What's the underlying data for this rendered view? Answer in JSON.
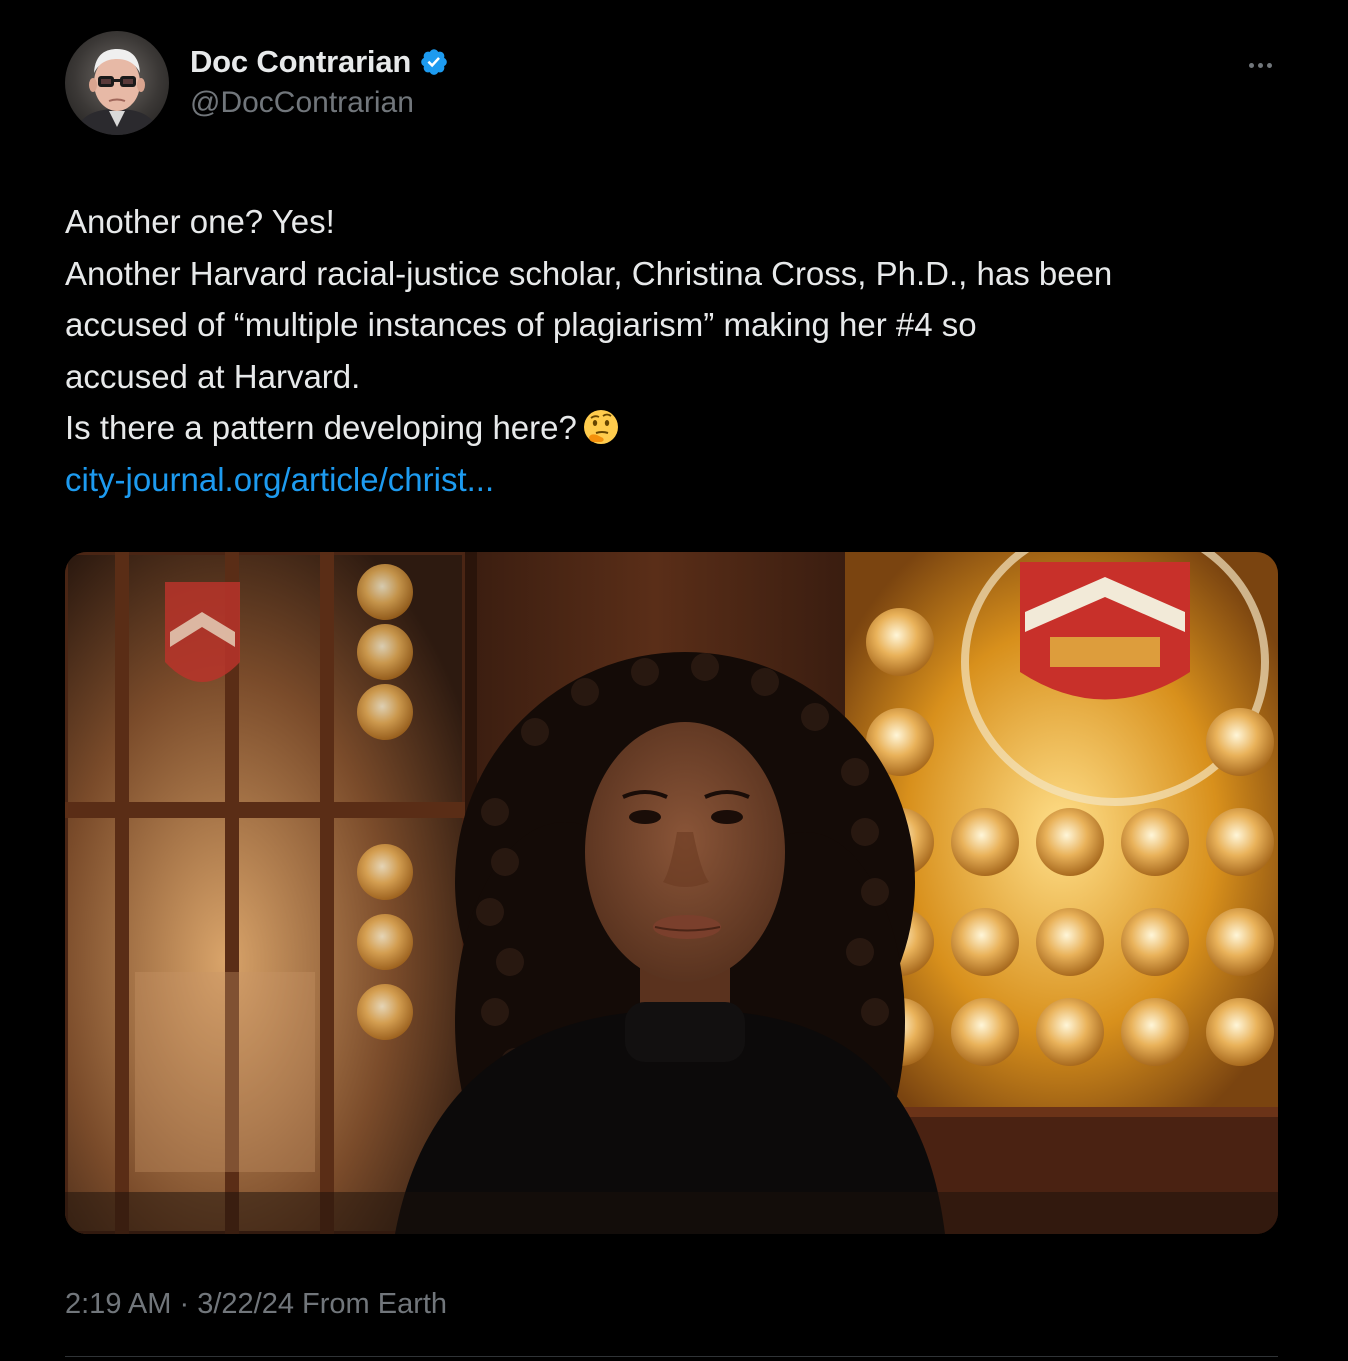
{
  "author": {
    "display_name": "Doc Contrarian",
    "handle": "@DocContrarian",
    "verified": true,
    "badge_color": "#1d9bf0"
  },
  "tweet": {
    "lines": [
      "Another one? Yes!",
      "Another Harvard racial-justice scholar, Christina Cross, Ph.D., has been",
      "accused of “multiple instances of plagiarism” making her #4 so",
      "accused at Harvard.",
      "Is there a pattern developing here?"
    ],
    "emoji": "thinking-face-emoji",
    "link_text": "city-journal.org/article/christ...",
    "link_color": "#1d9bf0"
  },
  "media": {
    "icon": "photo-woman-stained-glass"
  },
  "meta": {
    "time": "2:19 AM",
    "separator": "·",
    "date": "3/22/24",
    "source": "From Earth"
  },
  "colors": {
    "background": "#000000",
    "text": "#e7e9ea",
    "muted": "#71767b"
  }
}
